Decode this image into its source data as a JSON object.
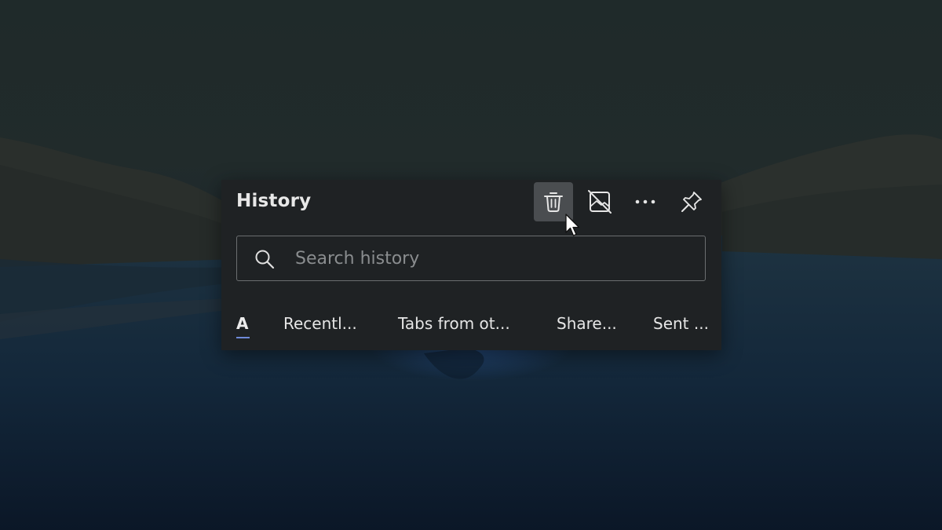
{
  "panel": {
    "title": "History",
    "toolbar": {
      "delete_icon": "trash-icon",
      "sync_off_icon": "image-off-icon",
      "more_icon": "more-horizontal-icon",
      "pin_icon": "pin-icon"
    }
  },
  "search": {
    "placeholder": "Search history",
    "value": ""
  },
  "tabs": {
    "all_label": "A",
    "items": [
      "Recentl...",
      "Tabs from ot...",
      "Share...",
      "Sent ..."
    ]
  },
  "colors": {
    "panel_bg": "#1f2224",
    "hover_bg": "#4a4d50",
    "accent": "#6f8ad8"
  }
}
